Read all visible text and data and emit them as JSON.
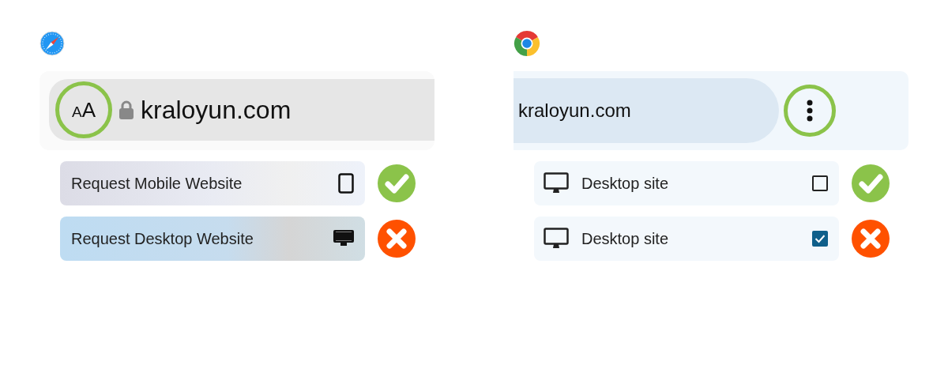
{
  "panels": [
    {
      "kind": "safari",
      "aa_button": "AA",
      "address": "kraloyun.com",
      "items": [
        {
          "label": "Request Mobile Website",
          "kind": "tablet",
          "approved": true
        },
        {
          "label": "Request Desktop Website",
          "kind": "desktop",
          "approved": false
        }
      ]
    },
    {
      "kind": "chrome",
      "address": "kraloyun.com",
      "items": [
        {
          "label": "Desktop site",
          "kind": "desktop",
          "checked": false,
          "approved": true
        },
        {
          "label": "Desktop site",
          "kind": "desktop",
          "checked": true,
          "approved": false
        }
      ]
    }
  ]
}
